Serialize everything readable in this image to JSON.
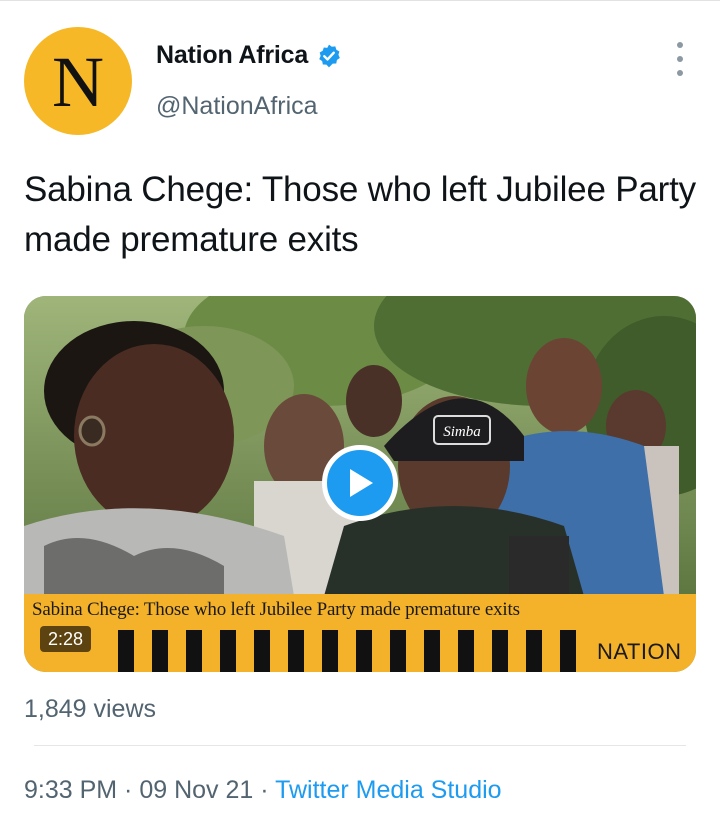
{
  "account": {
    "avatar_letter": "N",
    "display_name": "Nation Africa",
    "handle": "@NationAfrica",
    "verified": true
  },
  "tweet": {
    "text": "Sabina Chege: Those who left Jubilee Party made premature exits"
  },
  "video": {
    "caption": "Sabina Chege: Those who left Jubilee Party made premature exits",
    "brand": "NATION",
    "duration": "2:28",
    "cap_text": "Simba"
  },
  "stats": {
    "views": "1,849 views"
  },
  "footer": {
    "time": "9:33 PM",
    "sep1": " · ",
    "date": "09 Nov 21",
    "sep2": " · ",
    "source": "Twitter Media Studio"
  },
  "colors": {
    "accent": "#1d9bf0",
    "avatar_bg": "#f6b826",
    "lower_third": "#f4b12a",
    "secondary_text": "#536471"
  },
  "icons": {
    "verified": "verified-badge-icon",
    "more": "more-options-icon",
    "play": "play-icon"
  }
}
